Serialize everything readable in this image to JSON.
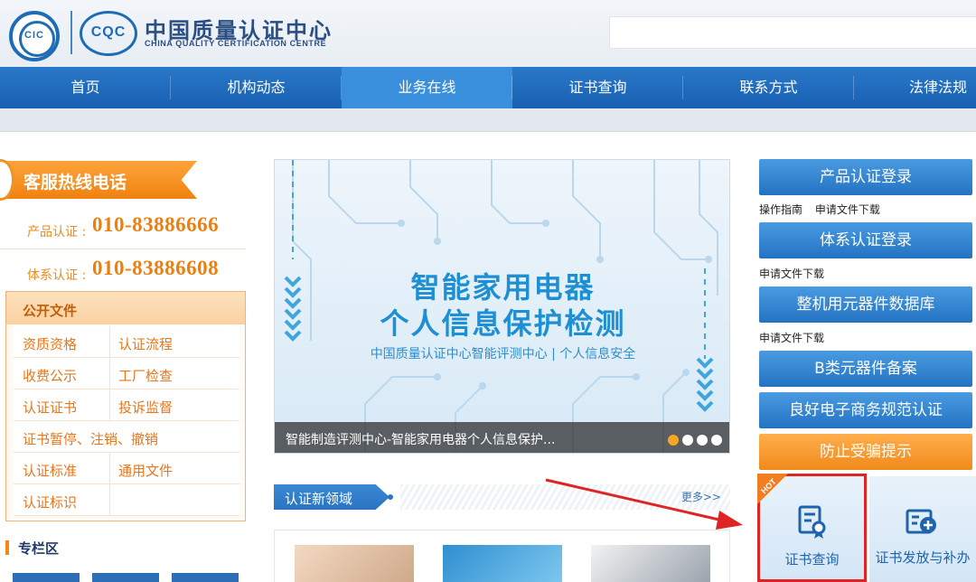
{
  "header": {
    "logo_left": "CIC",
    "logo_right": "CQC",
    "brand_cn": "中国质量认证中心",
    "brand_en": "CHINA QUALITY CERTIFICATION CENTRE"
  },
  "nav": {
    "items": [
      "首页",
      "机构动态",
      "业务在线",
      "证书查询",
      "联系方式",
      "法律法规"
    ],
    "active_index": 2
  },
  "hotline": {
    "title": "客服热线电话",
    "rows": [
      {
        "label": "产品认证 :",
        "number": "010-83886666"
      },
      {
        "label": "体系认证 :",
        "number": "010-83886608"
      }
    ]
  },
  "files": {
    "title": "公开文件",
    "rows": [
      [
        "资质资格",
        "认证流程"
      ],
      [
        "收费公示",
        "工厂检查"
      ],
      [
        "认证证书",
        "投诉监督"
      ],
      [
        "证书暂停、注销、撤销",
        ""
      ],
      [
        "认证标准",
        "通用文件"
      ],
      [
        "认证标识",
        ""
      ]
    ]
  },
  "zone": {
    "title": "专栏区"
  },
  "banner": {
    "title1": "智能家用电器",
    "title2": "个人信息保护检测",
    "subtitle": "中国质量认证中心智能评测中心 | 个人信息安全",
    "caption": "智能制造评测中心-智能家用电器个人信息保护...",
    "slides": 4,
    "active_slide": 0
  },
  "section": {
    "title": "认证新领域",
    "more": "更多>>"
  },
  "right": {
    "buttons": [
      {
        "label": "产品认证登录",
        "links": [
          "操作指南",
          "申请文件下载"
        ]
      },
      {
        "label": "体系认证登录",
        "links": [
          "申请文件下载"
        ]
      },
      {
        "label": "整机用元器件数据库",
        "links": [
          "申请文件下载"
        ]
      },
      {
        "label": "B类元器件备案",
        "links": []
      },
      {
        "label": "良好电子商务规范认证",
        "links": []
      },
      {
        "label": "防止受骗提示",
        "links": []
      }
    ],
    "cards": [
      {
        "label": "证书查询",
        "badge": "HOT"
      },
      {
        "label": "证书发放与补办"
      }
    ]
  },
  "colors": {
    "nav_blue": "#1860b2",
    "nav_active": "#3a8fdc",
    "orange": "#f08a1c",
    "highlight_red": "#e02424"
  }
}
